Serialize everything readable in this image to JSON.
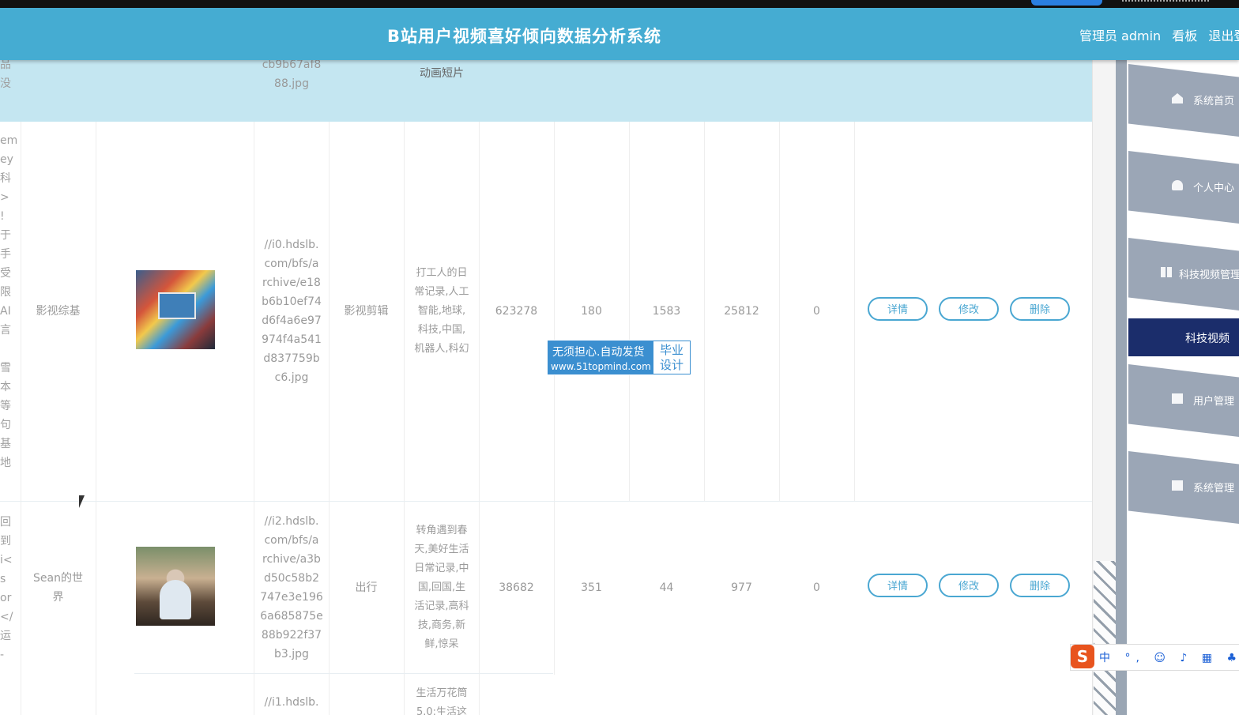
{
  "app": {
    "title": "B站用户视频喜好倾向数据分析系统",
    "user_role": "管理员",
    "username": "admin",
    "dashboard_link": "看板",
    "logout_link": "退出登"
  },
  "table": {
    "partial_top_row": {
      "left_fragment": [
        "品",
        "没"
      ],
      "image_url": [
        "cb9b67af8",
        "88.jpg"
      ],
      "category": "动画短片"
    },
    "rows": [
      {
        "left_fragment": [
          "em",
          "ey",
          "科",
          ">",
          "!",
          "于",
          "手",
          "受",
          "限",
          "AI",
          "言",
          "",
          "雪",
          "本",
          "等",
          "句",
          "基",
          "地"
        ],
        "author": "影视综基",
        "image_url": [
          "//i0.hdslb.",
          "com/bfs/a",
          "rchive/e18",
          "b6b10ef74",
          "d6f4a6e97",
          "974f4a541",
          "d837759b",
          "c6.jpg"
        ],
        "category": "影视剪辑",
        "tags": [
          "打工人的日",
          "常记录,人工",
          "智能,地球,",
          "科技,中国,",
          "机器人,科幻"
        ],
        "views": "623278",
        "col_a": "180",
        "col_b": "1583",
        "col_c": "25812",
        "col_d": "0"
      },
      {
        "left_fragment": [
          "回",
          "到",
          "i<",
          "s",
          "or",
          "</",
          "运",
          "-"
        ],
        "author": [
          "Sean的世",
          "界"
        ],
        "image_url": [
          "//i2.hdslb.",
          "com/bfs/a",
          "rchive/a3b",
          "d50c58b2",
          "747e3e196",
          "6a685875e",
          "88b922f37",
          "b3.jpg"
        ],
        "category": "出行",
        "tags": [
          "转角遇到春",
          "天,美好生活",
          "日常记录,中",
          "国,回国,生",
          "活记录,高科",
          "技,商务,新",
          "鲜,惊呆"
        ],
        "views": "38682",
        "col_a": "351",
        "col_b": "44",
        "col_c": "977",
        "col_d": "0"
      }
    ],
    "partial_bottom_row": {
      "image_url": "//i1.hdslb.",
      "tags": [
        "生活万花筒",
        "5.0:生活这"
      ]
    },
    "actions": {
      "detail": "详情",
      "edit": "修改",
      "delete": "删除"
    }
  },
  "watermark": {
    "line1": "无须担心.自动发货",
    "line2": "www.51topmind.com",
    "badge": [
      "毕业",
      "设计"
    ]
  },
  "sidebar": {
    "items": [
      {
        "label": "系统首页",
        "icon": "home-icon"
      },
      {
        "label": "个人中心",
        "icon": "user-icon"
      },
      {
        "label": "科技视频管理",
        "icon": "grid-icon"
      },
      {
        "label": "用户管理",
        "icon": "clipboard-icon"
      },
      {
        "label": "系统管理",
        "icon": "folder-icon"
      }
    ],
    "active_item": "科技视频"
  },
  "ime": {
    "logo": "S",
    "items": "中 °, ☺ ♪ ▦ ♣ ♥ 简"
  },
  "colors": {
    "navbar": "#45acd2",
    "highlight_row": "#c4e6f1",
    "button_border": "#4aa7d2",
    "sidebar_item": "#9ba6b6",
    "sidebar_active": "#1b2d6b"
  }
}
